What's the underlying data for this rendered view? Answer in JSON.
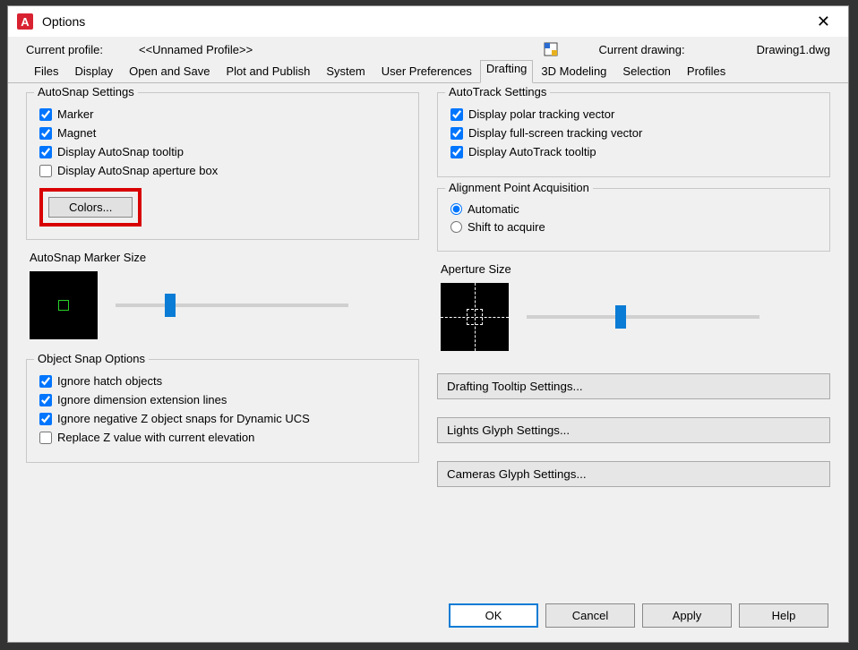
{
  "window": {
    "title": "Options"
  },
  "profile": {
    "label": "Current profile:",
    "value": "<<Unnamed Profile>>",
    "drawingLabel": "Current drawing:",
    "drawingValue": "Drawing1.dwg"
  },
  "tabs": {
    "items": [
      "Files",
      "Display",
      "Open and Save",
      "Plot and Publish",
      "System",
      "User Preferences",
      "Drafting",
      "3D Modeling",
      "Selection",
      "Profiles"
    ],
    "activeIndex": 6
  },
  "autosnap": {
    "title": "AutoSnap Settings",
    "marker": "Marker",
    "magnet": "Magnet",
    "tooltip": "Display AutoSnap tooltip",
    "aperture": "Display AutoSnap aperture box",
    "colors": "Colors..."
  },
  "markerSize": {
    "title": "AutoSnap Marker Size"
  },
  "osnap": {
    "title": "Object Snap Options",
    "hatch": "Ignore hatch objects",
    "dim": "Ignore dimension extension lines",
    "negz": "Ignore negative Z object snaps for Dynamic UCS",
    "replacez": "Replace Z value with current elevation"
  },
  "autotrack": {
    "title": "AutoTrack Settings",
    "polar": "Display polar tracking vector",
    "full": "Display full-screen tracking vector",
    "tooltip": "Display AutoTrack tooltip"
  },
  "align": {
    "title": "Alignment Point Acquisition",
    "auto": "Automatic",
    "shift": "Shift to acquire"
  },
  "apertureSize": {
    "title": "Aperture Size"
  },
  "buttons": {
    "tooltip": "Drafting Tooltip Settings...",
    "lights": "Lights Glyph Settings...",
    "cameras": "Cameras Glyph Settings..."
  },
  "footer": {
    "ok": "OK",
    "cancel": "Cancel",
    "apply": "Apply",
    "help": "Help"
  }
}
